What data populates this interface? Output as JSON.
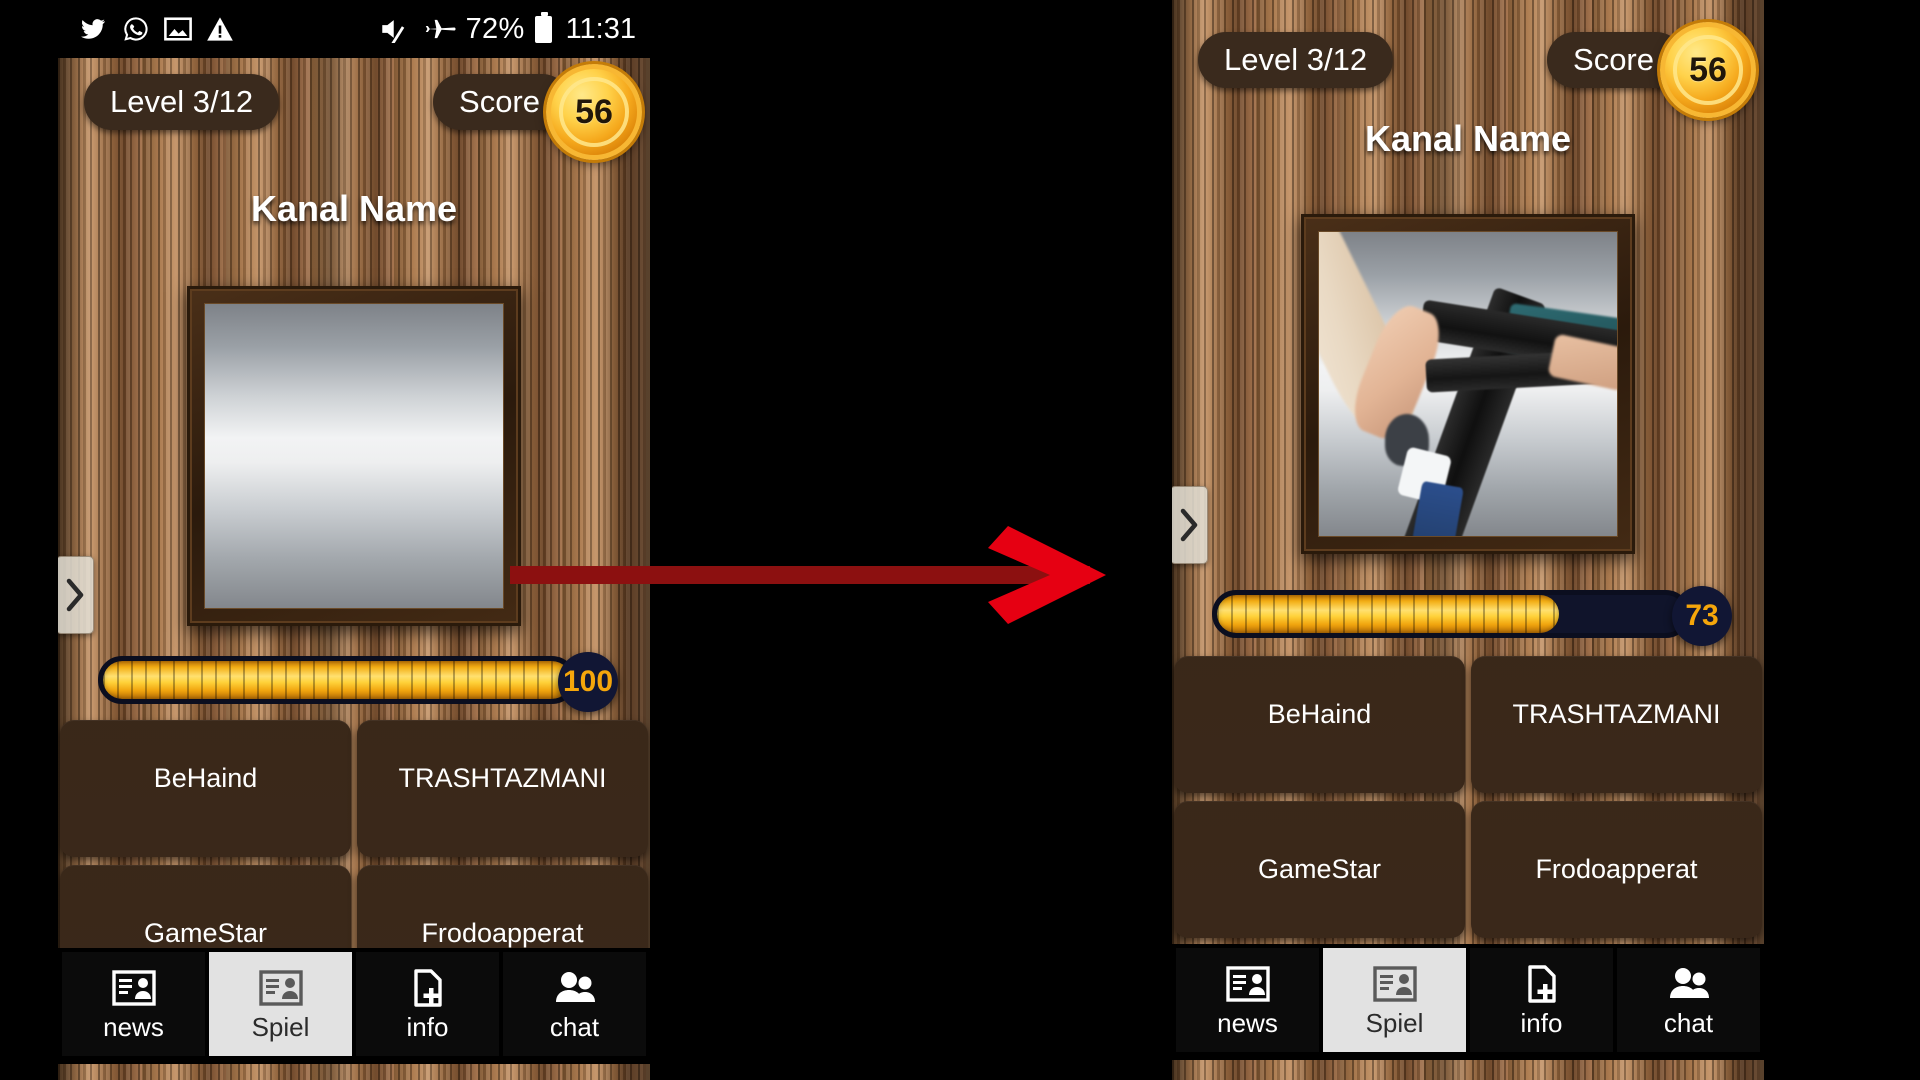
{
  "status_bar": {
    "icons": [
      "twitter-icon",
      "whatsapp-icon",
      "image-icon",
      "warning-icon",
      "mute-icon",
      "airplane-mode-icon",
      "battery-icon"
    ],
    "battery_percent": "72%",
    "time": "11:31"
  },
  "panels": [
    {
      "id": "before",
      "level_label": "Level 3/12",
      "score_label": "Score",
      "score_value": "56",
      "title": "Kanal Name",
      "image_state": "hidden",
      "progress_value": "100",
      "progress_percent": 100,
      "answers": [
        "BeHaind",
        "TRASHTAZMANI",
        "GameStar",
        "Frodoapperat"
      ],
      "tabs": [
        {
          "label": "news",
          "icon": "contact-card-icon",
          "active": false
        },
        {
          "label": "Spiel",
          "icon": "contact-card-icon",
          "active": true
        },
        {
          "label": "info",
          "icon": "add-document-icon",
          "active": false
        },
        {
          "label": "chat",
          "icon": "people-icon",
          "active": false
        }
      ],
      "side_nav_icon": "chevron-right-icon"
    },
    {
      "id": "after",
      "level_label": "Level 3/12",
      "score_label": "Score",
      "score_value": "56",
      "title": "Kanal Name",
      "image_state": "revealed",
      "progress_value": "73",
      "progress_percent": 73,
      "answers": [
        "BeHaind",
        "TRASHTAZMANI",
        "GameStar",
        "Frodoapperat"
      ],
      "tabs": [
        {
          "label": "news",
          "icon": "contact-card-icon",
          "active": false
        },
        {
          "label": "Spiel",
          "icon": "contact-card-icon",
          "active": true
        },
        {
          "label": "info",
          "icon": "add-document-icon",
          "active": false
        },
        {
          "label": "chat",
          "icon": "people-icon",
          "active": false
        }
      ],
      "side_nav_icon": "chevron-right-icon"
    }
  ],
  "annotation": {
    "arrow_icon": "right-arrow-annotation",
    "arrow_color": "#e60012",
    "arrow_shaft_color": "#8c1010"
  },
  "colors": {
    "wood": "#9a6a3e",
    "pill": "#3a2a1d",
    "coin": "#f5a81c",
    "progress_fill": "#ffd23a",
    "progress_track": "#10142b",
    "progress_value_text": "#f5a60b",
    "answer_button": "#3a2819",
    "tab_active_bg": "#e2e2e2",
    "tab_bg": "#0b0b0b"
  }
}
